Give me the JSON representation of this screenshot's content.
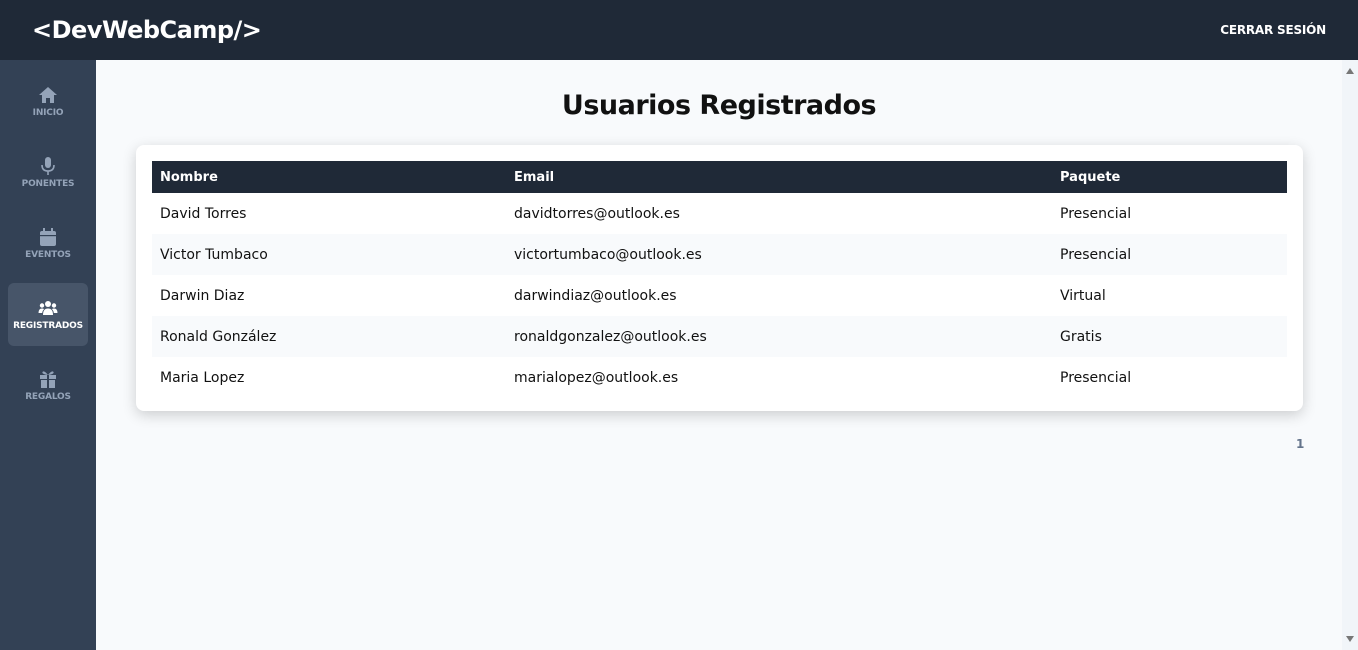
{
  "header": {
    "logo": "<DevWebCamp/>",
    "logout_label": "CERRAR SESIÓN"
  },
  "sidebar": {
    "items": [
      {
        "label": "INICIO",
        "icon": "home-icon"
      },
      {
        "label": "PONENTES",
        "icon": "microphone-icon"
      },
      {
        "label": "EVENTOS",
        "icon": "calendar-icon"
      },
      {
        "label": "REGISTRADOS",
        "icon": "users-icon",
        "active": true
      },
      {
        "label": "REGALOS",
        "icon": "gift-icon"
      }
    ]
  },
  "main": {
    "title": "Usuarios Registrados",
    "table": {
      "headers": [
        "Nombre",
        "Email",
        "Paquete"
      ],
      "rows": [
        [
          "David Torres",
          "davidtorres@outlook.es",
          "Presencial"
        ],
        [
          "Victor Tumbaco",
          "victortumbaco@outlook.es",
          "Presencial"
        ],
        [
          "Darwin Diaz",
          "darwindiaz@outlook.es",
          "Virtual"
        ],
        [
          "Ronald González",
          "ronaldgonzalez@outlook.es",
          "Gratis"
        ],
        [
          "Maria Lopez",
          "marialopez@outlook.es",
          "Presencial"
        ]
      ]
    },
    "pagination": {
      "current_page": "1"
    }
  },
  "colors": {
    "header_bg": "#1f2937",
    "sidebar_bg": "#334155",
    "sidebar_active": "#475569",
    "page_bg": "#f8fafc"
  }
}
